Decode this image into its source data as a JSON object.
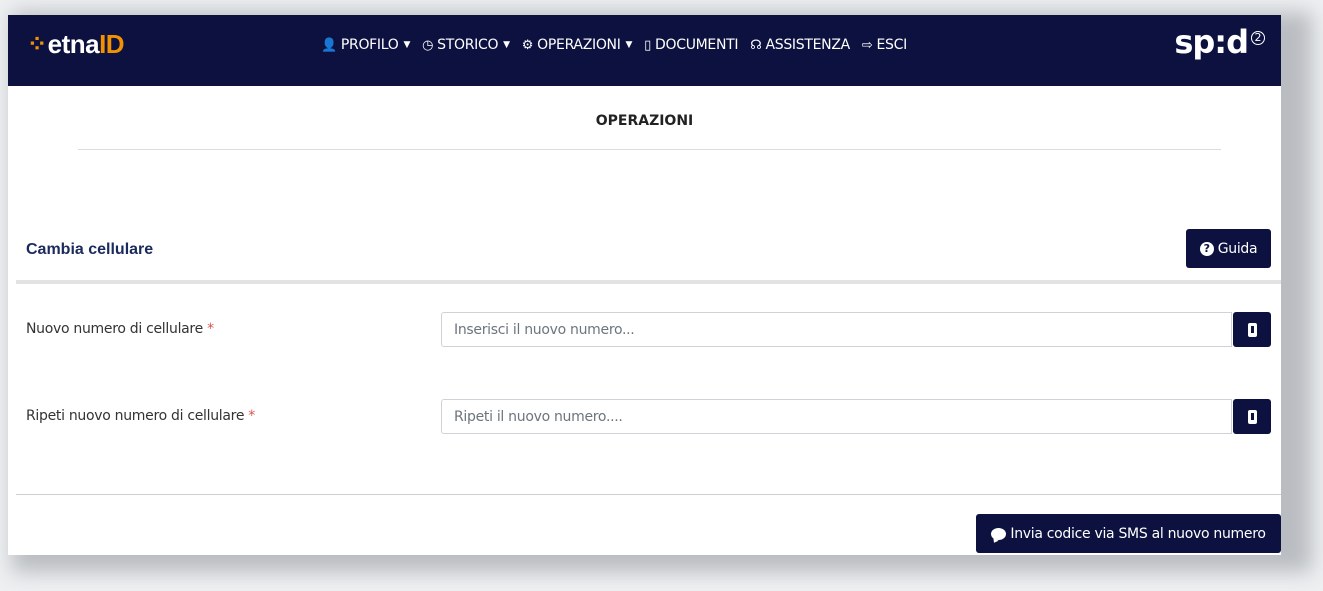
{
  "brand": {
    "mark": "⁘",
    "name": "etna",
    "id": "ID"
  },
  "nav": [
    {
      "icon": "user-icon",
      "glyph": "👤",
      "label": "PROFILO",
      "dropdown": true
    },
    {
      "icon": "history-icon",
      "glyph": "◷",
      "label": "STORICO",
      "dropdown": true
    },
    {
      "icon": "gear-icon",
      "glyph": "⚙",
      "label": "OPERAZIONI",
      "dropdown": true
    },
    {
      "icon": "document-icon",
      "glyph": "▯",
      "label": "DOCUMENTI",
      "dropdown": false
    },
    {
      "icon": "headset-icon",
      "glyph": "☊",
      "label": "ASSISTENZA",
      "dropdown": false
    },
    {
      "icon": "logout-icon",
      "glyph": "⇨",
      "label": "ESCI",
      "dropdown": false
    }
  ],
  "spid": {
    "text": "sp:d",
    "level": "2"
  },
  "page": {
    "title": "OPERAZIONI"
  },
  "section": {
    "title": "Cambia cellulare",
    "guide_label": "Guida"
  },
  "fields": [
    {
      "label": "Nuovo numero di cellulare",
      "required": "*",
      "placeholder": "Inserisci il nuovo numero...",
      "value": ""
    },
    {
      "label": "Ripeti nuovo numero di cellulare",
      "required": "*",
      "placeholder": "Ripeti il nuovo numero....",
      "value": ""
    }
  ],
  "actions": {
    "send_sms_label": "Invia codice via SMS al nuovo numero"
  },
  "colors": {
    "navbar": "#0d1140",
    "brand_accent": "#f39200",
    "required": "#d9534f",
    "section_title": "#1a2a5c"
  }
}
